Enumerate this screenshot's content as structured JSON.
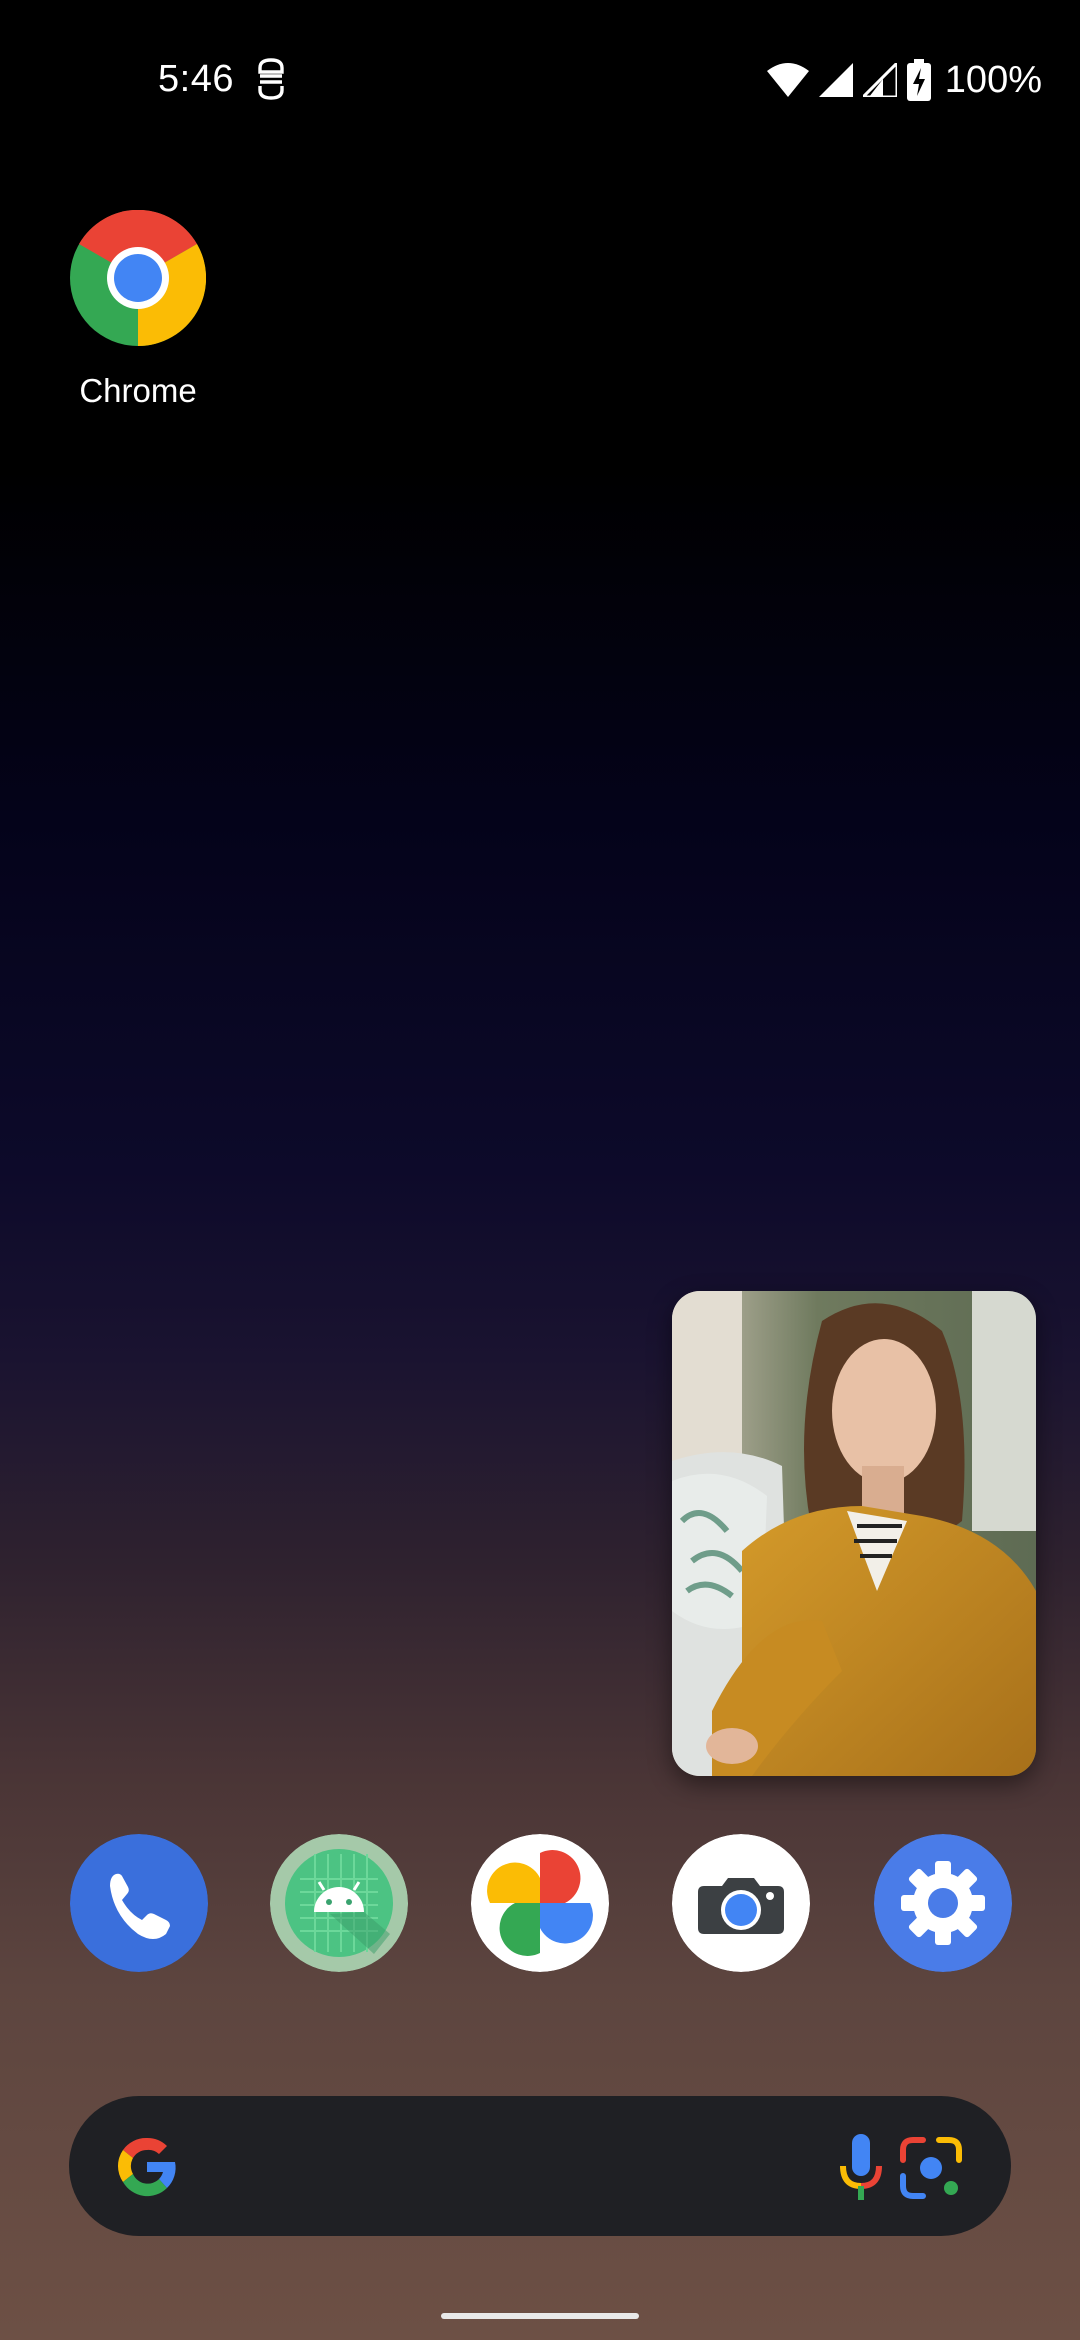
{
  "status_bar": {
    "time": "5:46",
    "battery_percent": "100%",
    "icons": [
      "status-badge-icon",
      "wifi-icon",
      "cell-signal-icon",
      "cell-signal-icon",
      "battery-charging-icon"
    ]
  },
  "home": {
    "shortcuts": [
      {
        "label": "Chrome",
        "icon": "chrome-icon"
      }
    ]
  },
  "pip": {
    "icon": "pip-video-thumbnail"
  },
  "dock": {
    "apps": [
      {
        "name": "phone",
        "icon": "phone-icon",
        "color": "#3a6fdc"
      },
      {
        "name": "android",
        "icon": "android-icon",
        "color": "#a5c9a9"
      },
      {
        "name": "photos",
        "icon": "photos-pinwheel-icon",
        "color": "#ffffff"
      },
      {
        "name": "camera",
        "icon": "camera-icon",
        "color": "#ffffff"
      },
      {
        "name": "settings",
        "icon": "gear-icon",
        "color": "#4a7ce8"
      }
    ]
  },
  "search": {
    "icons": [
      "google-g-icon",
      "microphone-icon",
      "lens-icon"
    ]
  },
  "colors": {
    "google_blue": "#4285f4",
    "google_red": "#ea4335",
    "google_yellow": "#fbbc05",
    "google_green": "#34a853",
    "search_bg": "#1f2024"
  }
}
